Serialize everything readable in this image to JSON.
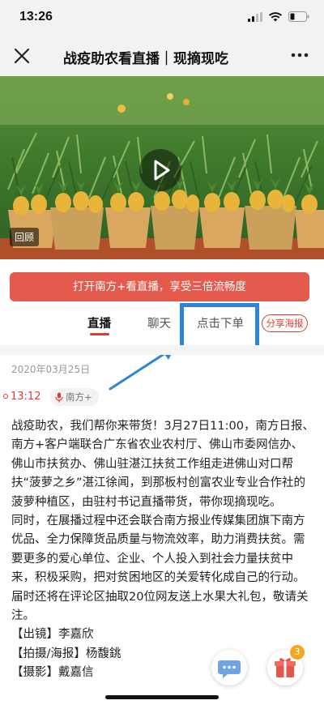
{
  "status_bar": {
    "time": "13:26"
  },
  "nav": {
    "title": "战疫助农看直播｜现摘现吃"
  },
  "video": {
    "replay_label": "回顾"
  },
  "banner": {
    "text": "打开南方+看直播，享受三倍流畅度"
  },
  "tabs": {
    "live": "直播",
    "chat": "聊天",
    "order": "点击下单",
    "share": "分享海报"
  },
  "feed": {
    "date": "2020年03月25日",
    "time": "13:12",
    "source": "南方+",
    "paragraphs": [
      "战疫助农，我们帮你来带货！3月27日11:00，南方日报、南方+客户端联合广东省农业农村厅、佛山市委网信办、佛山市扶贫办、佛山驻湛江扶贫工作组走进佛山对口帮扶“菠萝之乡”湛江徐闻，到那板村创富农业专业合作社的菠萝种植区，由驻村书记直播带货，带你现摘现吃。",
      "同时，在展播过程中还会联合南方报业传媒集团旗下南方优品、全力保障货品质量与物流效率，助力消费扶贫。需要更多的爱心单位、企业、个人投入到社会力量扶贫中来，积极采购，把对贫困地区的关爱转化成自己的行动。届时还将在评论区抽取20位网友送上水果大礼包，敬请关注。",
      "【出镜】李嘉欣",
      "【拍摄/海报】杨馥銚",
      "【摄影】戴嘉信"
    ]
  },
  "gift_badge_count": "3",
  "colors": {
    "accent_red": "#e03b33",
    "banner_red": "#e45a4c",
    "highlight_blue": "#2f83d8",
    "badge_orange": "#f5a623"
  }
}
